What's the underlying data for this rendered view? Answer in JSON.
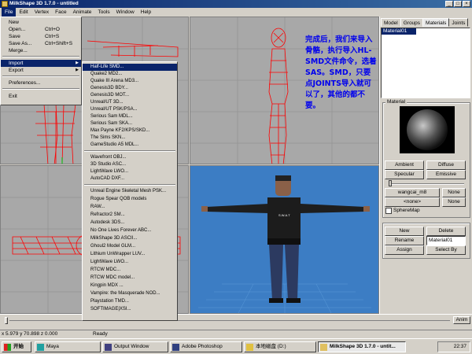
{
  "window": {
    "title": "MilkShape 3D 1.7.0 - untitled",
    "controls": [
      "_",
      "□",
      "×"
    ]
  },
  "menubar": [
    "File",
    "Edit",
    "Vertex",
    "Face",
    "Animate",
    "Tools",
    "Window",
    "Help"
  ],
  "file_menu": {
    "items": [
      {
        "label": "New",
        "shortcut": ""
      },
      {
        "label": "Open...",
        "shortcut": "Ctrl+O"
      },
      {
        "label": "Save",
        "shortcut": "Ctrl+S"
      },
      {
        "label": "Save As...",
        "shortcut": "Ctrl+Shift+S"
      },
      {
        "label": "Merge...",
        "shortcut": ""
      },
      {
        "label": "Import",
        "shortcut": "",
        "submenu": true
      },
      {
        "label": "Export",
        "shortcut": "",
        "submenu": true
      },
      {
        "label": "Preferences...",
        "shortcut": ""
      },
      {
        "label": "Exit",
        "shortcut": ""
      }
    ]
  },
  "import_submenu": {
    "group1": [
      "Half-Life SMD...",
      "Quake2 MD2...",
      "Quake III Arena MD3...",
      "Genesis3D BDY...",
      "Genesis3D MOT...",
      "Unreal/UT 3D...",
      "Unreal/UT PSK/PSA...",
      "Serious Sam MDL...",
      "Serious Sam SKA...",
      "Max Payne KF2/KPS/SKD...",
      "The Sims SKN...",
      "GameStudio A5 MDL..."
    ],
    "group2": [
      "Wavefront OBJ...",
      "3D Studio ASC...",
      "LightWave LWO...",
      "AutoCAD DXF..."
    ],
    "group3": [
      "Unreal Engine Skeletal Mesh PSK...",
      "Rogue Spear QOB models",
      "RAW...",
      "Refractor2 SM...",
      "Autodesk 3DS...",
      "No One Lives Forever ABC...",
      "MilkShape 3D ASCII...",
      "Ghoul2 Model GLM...",
      "Lithium UnWrapper LUV...",
      "LightWave LWO...",
      "RTCW MDC...",
      "RTCW MDC model...",
      "Kingpin MDX ...",
      "Vampire: the Masquerade NOD...",
      "Playstation TMD...",
      "SOFTIMAGE|XSI..."
    ]
  },
  "annotation": "完成后，我们来导入骨骼，执行导入HL-SMD文件命令，选着SAS。SMD，只要点JOINTS导入就可以了，其他的都不要。",
  "panel": {
    "tabs": [
      "Model",
      "Groups",
      "Materials",
      "Joints"
    ],
    "active_tab": "Materials",
    "materials": [
      "Material01"
    ],
    "material_group_label": "Material",
    "buttons": {
      "ambient": "Ambient",
      "diffuse": "Diffuse",
      "specular": "Specular",
      "emissive": "Emissive",
      "texture": "wangcai_m8",
      "none1": "None",
      "alpha": "<none>",
      "none2": "None",
      "new": "New",
      "delete": "Delete",
      "rename": "Rename",
      "assign": "Assign",
      "select_by": "Select By"
    },
    "spheremap_label": "SphereMap",
    "name_field": "Material01"
  },
  "status": {
    "coords": "x 5.979 y 70.898 z 0.000",
    "text": "Ready"
  },
  "timeline": {
    "anim_label": "Anim"
  },
  "taskbar": {
    "start": "开始",
    "tasks": [
      "Maya",
      "Output Window",
      "Adobe Photoshop",
      "本地磁盘 (D:)",
      "MilkShape 3D 1.7.0 - untit..."
    ],
    "active_task": "MilkShape 3D 1.7.0 - untit...",
    "clock": "22:37"
  },
  "colors": {
    "wire": "#ff0000",
    "viewport_bg": "#a8a8a8",
    "viewport_3d_bg": "#3c7dc4",
    "title_blue": "#0a246a",
    "annotation": "#0000ee"
  }
}
